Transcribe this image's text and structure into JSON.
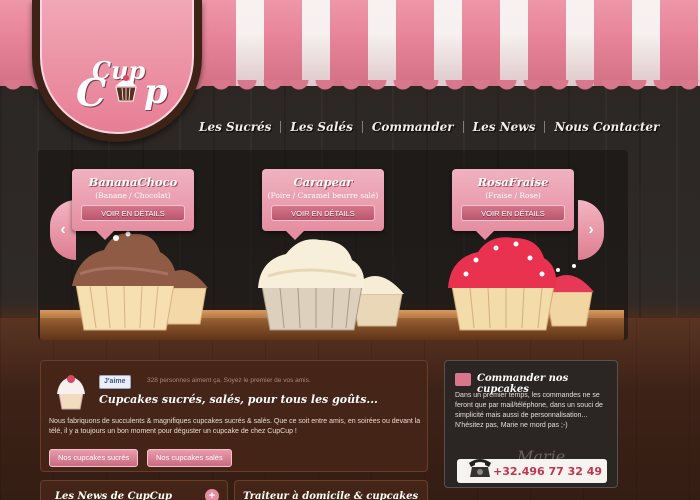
{
  "logo": {
    "text_cup1": "Cup",
    "text_cup2": "C",
    "text_cup3": "p"
  },
  "nav": {
    "items": [
      "Les Sucrés",
      "Les Salés",
      "Commander",
      "Les News",
      "Nous Contacter"
    ]
  },
  "products": [
    {
      "name": "BananaChoco",
      "sub": "(Banane / Chocolat)",
      "button": "VOIR EN DÉTAILS"
    },
    {
      "name": "Carapear",
      "sub": "(Poire / Caramel beurre salé)",
      "button": "VOIR EN DÉTAILS"
    },
    {
      "name": "RosaFraise",
      "sub": "(Fraise / Rose)",
      "button": "VOIR EN DÉTAILS"
    }
  ],
  "arrows": {
    "left": "‹",
    "right": "›"
  },
  "intro": {
    "like_label": "J'aime",
    "like_count": "328 personnes aiment ça. Soyez le premier de vos amis.",
    "title": "Cupcakes sucrés, salés, pour tous les goûts...",
    "text": "Nous fabriquons de succulents & magnifiques cupcakes sucrés & salés. Que ce soit entre amis, en soirées ou devant la télé, il y a toujours un bon moment pour déguster un cupcake de chez CupCup !",
    "btn_sucres": "Nos cupcakes sucrés",
    "btn_sales": "Nos cupcakes salés"
  },
  "order": {
    "title": "Commander nos cupcakes",
    "text": "Dans un premier temps, les commandes ne se feront que par mail/téléphone, dans un souci de simplicité mais aussi de personnalisation... N'hésitez pas, Marie ne mord pas ;-)",
    "signature": "Marie",
    "phone": "+32.496 77 32 49"
  },
  "news": {
    "title": "Les News de CupCup",
    "plus": "+"
  },
  "traiteur": {
    "title": "Traiteur à domicile & cupcakes"
  },
  "colors": {
    "pink": "#e9859a",
    "brown": "#3d2217"
  }
}
